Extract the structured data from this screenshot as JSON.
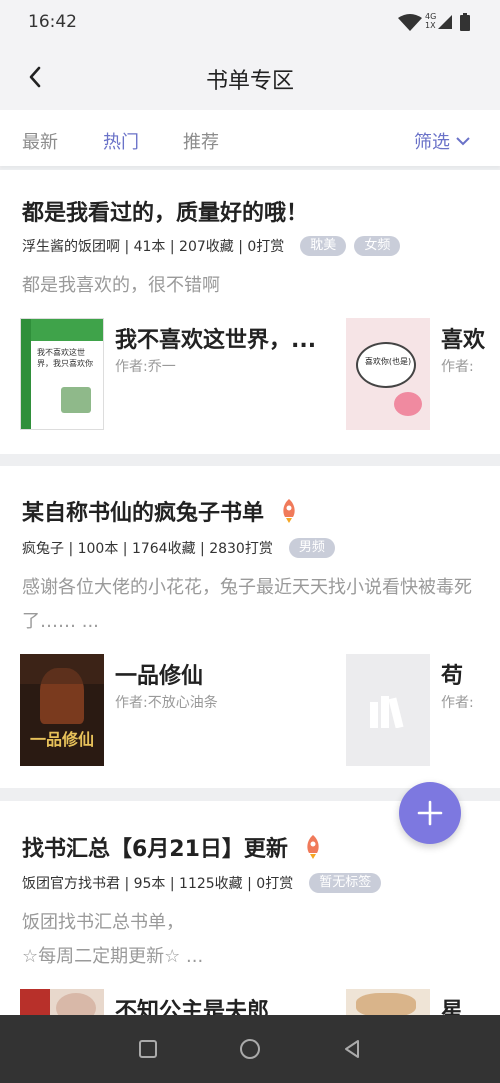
{
  "status_bar": {
    "time": "16:42",
    "network": "4G",
    "network_sub": "1X"
  },
  "header": {
    "title": "书单专区"
  },
  "tabs": [
    {
      "label": "最新",
      "active": false
    },
    {
      "label": "热门",
      "active": true
    },
    {
      "label": "推荐",
      "active": false
    }
  ],
  "filter_label": "筛选",
  "accent_color": "#6a72c8",
  "cards": [
    {
      "title": "都是我看过的，质量好的哦！",
      "meta": "浮生酱的饭团啊 | 41本 | 207收藏 | 0打赏",
      "tags": [
        "耽美",
        "女频"
      ],
      "description": "都是我喜欢的，很不错啊",
      "books": [
        {
          "name": "我不喜欢这世界，...",
          "author": "作者:乔一"
        },
        {
          "name": "喜欢",
          "author": "作者:"
        }
      ]
    },
    {
      "title": "某自称书仙的疯兔子书单",
      "meta": "疯兔子 | 100本 | 1764收藏 | 2830打赏",
      "tags": [
        "男频"
      ],
      "description": "感谢各位大佬的小花花，兔子最近天天找小说看快被毒死了…… ...",
      "books": [
        {
          "name": "一品修仙",
          "author": "作者:不放心油条"
        },
        {
          "name": "苟",
          "author": "作者:"
        }
      ]
    },
    {
      "title": "找书汇总【6月21日】更新",
      "meta": "饭团官方找书君 | 95本 | 1125收藏 | 0打赏",
      "tags": [
        "暂无标签"
      ],
      "description_lines": [
        "饭团找书汇总书单，",
        "☆每周二定期更新☆ ..."
      ],
      "books": [
        {
          "name": "不知公主是夫郎",
          "author": ""
        },
        {
          "name": "星",
          "author": ""
        }
      ]
    }
  ],
  "cover_texts": {
    "book1": "我不喜欢这世界，我只喜欢你",
    "book2": "喜欢你(也是)",
    "book3": "一品修仙"
  }
}
